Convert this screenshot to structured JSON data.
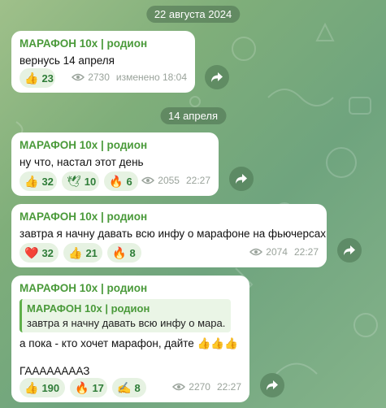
{
  "dates": [
    "22 августа 2024",
    "14 апреля"
  ],
  "messages": [
    {
      "sender": "МАРАФОН 10х | родион",
      "text": "вернусь 14 апреля",
      "reactions": [
        {
          "emoji": "👍",
          "count": "23"
        }
      ],
      "views": "2730",
      "time": "изменено 18:04"
    },
    {
      "sender": "МАРАФОН 10х | родион",
      "text": "ну что, настал этот день",
      "reactions": [
        {
          "emoji": "🕊",
          "count": "32"
        },
        {
          "emoji": "🕊",
          "count": "10"
        },
        {
          "emoji": "🔥",
          "count": "6"
        }
      ],
      "views": "2055",
      "time": "22:27"
    },
    {
      "sender": "МАРАФОН 10х | родион",
      "text": "завтра я начну давать всю инфу о марафоне на фьючерсах",
      "reactions": [
        {
          "emoji": "❤️",
          "count": "32"
        },
        {
          "emoji": "👍",
          "count": "21"
        },
        {
          "emoji": "🔥",
          "count": "8"
        }
      ],
      "views": "2074",
      "time": "22:27"
    },
    {
      "sender": "МАРАФОН 10х | родион",
      "quote_sender": "МАРАФОН 10х | родион",
      "quote_text": "завтра я начну давать всю инфу о мара...",
      "text": "а пока - кто хочет марафон, дайте 👍👍👍",
      "text2": "ГААААААААЗ",
      "reactions": [
        {
          "emoji": "👍",
          "count": "190"
        },
        {
          "emoji": "🔥",
          "count": "17"
        },
        {
          "emoji": "✍️",
          "count": "8"
        }
      ],
      "views": "2270",
      "time": "22:27"
    }
  ],
  "reaction_emoji_overrides": {
    "m2r0": "👍",
    "m2r1": "🕊"
  },
  "colors": {
    "accent": "#4a9a3a",
    "reaction_bg": "#e6f2e2",
    "reaction_text": "#2f7d38"
  }
}
